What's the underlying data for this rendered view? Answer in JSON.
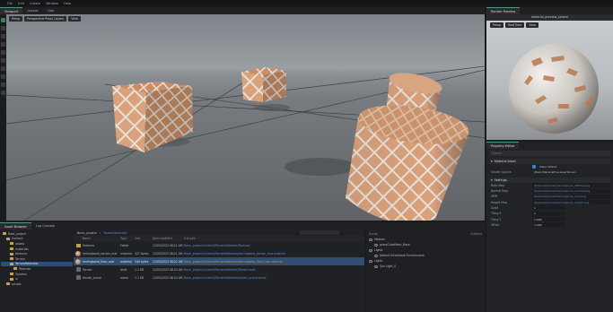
{
  "menubar": {
    "items": [
      "File",
      "Edit",
      "Create",
      "Window",
      "Help"
    ]
  },
  "viewport": {
    "tabs": [
      "Viewport",
      "Layout",
      "Cam"
    ],
    "controls": [
      "Persp",
      "Perspective Proxy Layers",
      "View"
    ]
  },
  "render_panel": {
    "tab": "Render Preview",
    "title": "material_preview_sphere",
    "buttons": [
      "Persp",
      "RealTime",
      "View"
    ]
  },
  "property_panel": {
    "tab": "Property Editor",
    "search_placeholder": "Search",
    "section_main": "Material Asset",
    "button_label": "Make default",
    "shader_label": "Shader Source",
    "shader_value": "/Basic/MaterialPreviews/Terrain",
    "section_settings": "Settings",
    "texture_rows": [
      {
        "key": "Base Map",
        "value": "/textures/terrain/herringbone_diffuse.png"
      },
      {
        "key": "Normal Map",
        "value": "/textures/terrain/herringbone_normal.png"
      },
      {
        "key": "ORM",
        "value": "/textures/terrain/herringbone_orm.png"
      },
      {
        "key": "Height Map",
        "value": "/textures/terrain/herringbone_height.png"
      }
    ],
    "numeric_rows": [
      {
        "key": "Scale",
        "value": "1"
      },
      {
        "key": "Tiling X",
        "value": "1"
      },
      {
        "key": "Tiling Y",
        "value": "1.000"
      },
      {
        "key": "Offset",
        "value": "1.000"
      }
    ]
  },
  "content_browser": {
    "tabs": [
      "Asset Browser",
      "Log Console"
    ],
    "tree": [
      "Root_project",
      "Content",
      "assets",
      "materials",
      "textures",
      "Terrain",
      "TerrainMaterials",
      "Textures",
      "Shaders",
      "ui",
      "scripts"
    ],
    "breadcrumb_prefix": "Basic_project",
    "breadcrumb_link": "TerrainMaterials",
    "columns": [
      "Name",
      "Type",
      "Size",
      "Date modified",
      "Full path"
    ],
    "rows": [
      {
        "name": "Textures",
        "type": "Folder",
        "size": "",
        "date": "12/05/2023 08:21 AM",
        "path": "Basic_project/Content/TerrainMaterials/Textures"
      },
      {
        "name": "herringbone_terrain_mat",
        "type": "material",
        "size": "327 bytes",
        "date": "12/05/2023 08:21 AM",
        "path": "Basic_project/Content/TerrainMaterials/herringbone_terrain_mat.material"
      },
      {
        "name": "herringbone_floor_mat",
        "type": "material",
        "size": "344 bytes",
        "date": "12/05/2023 08:22 AM",
        "path": "Basic_project/Content/TerrainMaterials/herringbone_floor_mat.material"
      },
      {
        "name": "Terrain",
        "type": "level",
        "size": "1.2 KB",
        "date": "12/05/2023 08:23 AM",
        "path": "Basic_project/Content/TerrainMaterials/Terrain.level"
      },
      {
        "name": "terrain_scene",
        "type": "scene",
        "size": "2.1 KB",
        "date": "12/05/2023 08:24 AM",
        "path": "Basic_project/Content/TerrainMaterials/terrain_scene.scene"
      }
    ]
  },
  "stage": {
    "tabs": [
      "Scene",
      "Outliner"
    ],
    "rows": [
      "Meshes",
      "grassCubeMesh_Base",
      "Lights",
      "Default Directional Environment",
      "Lights",
      "Sun Light_0"
    ]
  }
}
